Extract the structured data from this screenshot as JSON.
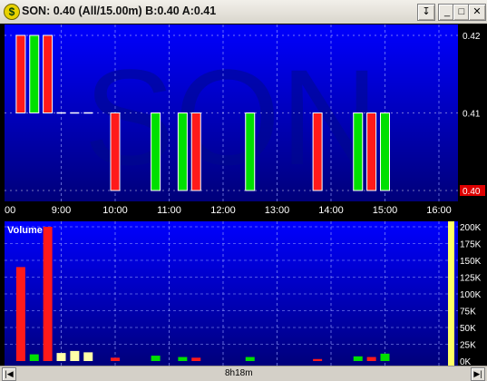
{
  "window": {
    "title": "SON: 0.40 (All/15.00m)  B:0.40 A:0.41",
    "buttons": {
      "pin": "↧",
      "minimize": "_",
      "maximize": "□",
      "close": "✕"
    }
  },
  "watermark": "SON",
  "colors": {
    "up": "#00e000",
    "down": "#ff1a1a",
    "volume_neutral": "#ffffa8",
    "background_top": "#0000ff",
    "background_bottom": "#00007a",
    "last_price_tag": "#dd0000",
    "volume_scale_bar": "#ffff66"
  },
  "price_panel": {
    "y_ticks": [
      "0.42",
      "0.41",
      "0.40"
    ],
    "last_price": "0.40",
    "x_ticks": [
      "00",
      "9:00",
      "10:00",
      "11:00",
      "12:00",
      "13:00",
      "14:00",
      "15:00",
      "16:00"
    ]
  },
  "volume_panel": {
    "label": "Volume",
    "y_ticks": [
      "200K",
      "175K",
      "150K",
      "125K",
      "100K",
      "75K",
      "50K",
      "25K",
      "0K"
    ]
  },
  "chart_data": {
    "type": "bar",
    "price_range": [
      0.4,
      0.42
    ],
    "volume_range": [
      0,
      200000
    ],
    "time_range": [
      "8:00",
      "16:30"
    ],
    "candles": [
      {
        "t": "8:15",
        "open": 0.42,
        "close": 0.41,
        "volume": 140000
      },
      {
        "t": "8:30",
        "open": 0.41,
        "close": 0.42,
        "volume": 10000
      },
      {
        "t": "8:45",
        "open": 0.42,
        "close": 0.41,
        "volume": 205000
      },
      {
        "t": "9:00",
        "open": 0.41,
        "close": 0.41,
        "volume": 12000
      },
      {
        "t": "9:15",
        "open": 0.41,
        "close": 0.41,
        "volume": 15000
      },
      {
        "t": "9:30",
        "open": 0.41,
        "close": 0.41,
        "volume": 13000
      },
      {
        "t": "10:00",
        "open": 0.41,
        "close": 0.4,
        "volume": 5000
      },
      {
        "t": "10:45",
        "open": 0.4,
        "close": 0.41,
        "volume": 8000
      },
      {
        "t": "11:15",
        "open": 0.4,
        "close": 0.41,
        "volume": 6000
      },
      {
        "t": "11:30",
        "open": 0.41,
        "close": 0.4,
        "volume": 5000
      },
      {
        "t": "12:30",
        "open": 0.4,
        "close": 0.41,
        "volume": 6000
      },
      {
        "t": "13:45",
        "open": 0.41,
        "close": 0.4,
        "volume": 3000
      },
      {
        "t": "14:30",
        "open": 0.4,
        "close": 0.41,
        "volume": 7000
      },
      {
        "t": "14:45",
        "open": 0.41,
        "close": 0.4,
        "volume": 6000
      },
      {
        "t": "15:00",
        "open": 0.4,
        "close": 0.41,
        "volume": 11000
      }
    ]
  },
  "scrollbar": {
    "label": "8h18m",
    "left": "|◀",
    "right": "▶|"
  }
}
